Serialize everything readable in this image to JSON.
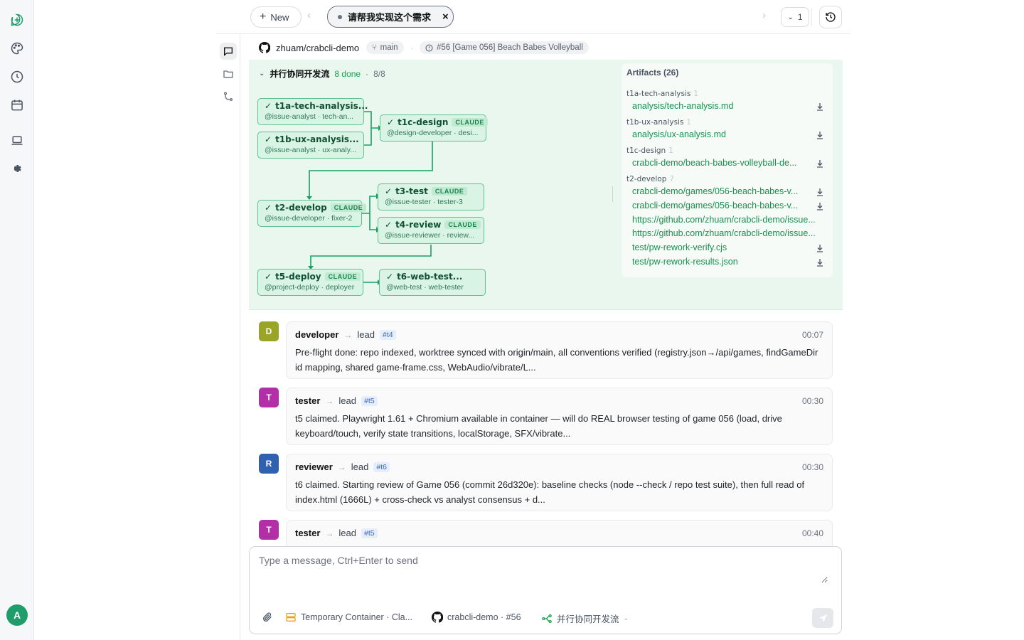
{
  "rail": {
    "icons": [
      "new-chat-icon",
      "palette-icon",
      "history-icon",
      "calendar-icon",
      "laptop-icon",
      "settings-icon"
    ],
    "user_initial": "A"
  },
  "topbar": {
    "new_label": "New",
    "active_tab": "请帮我实现这个需求",
    "count": "1"
  },
  "repo": {
    "name": "zhuam/crabcli-demo",
    "branch": "main",
    "issue": "#56 [Game 056] Beach Babes Volleyball"
  },
  "workflow": {
    "name": "并行协同开发流",
    "done": "8 done",
    "ratio": "8/8",
    "badge": "CLAUDE",
    "nodes": [
      {
        "title": "t1a-tech-analysis...",
        "sub": "@issue-analyst · tech-an..."
      },
      {
        "title": "t1b-ux-analysis...",
        "sub": "@issue-analyst · ux-analy..."
      },
      {
        "title": "t1c-design",
        "sub": "@design-developer · desi..."
      },
      {
        "title": "t2-develop",
        "sub": "@issue-developer · fixer-2"
      },
      {
        "title": "t3-test",
        "sub": "@issue-tester · tester-3"
      },
      {
        "title": "t4-review",
        "sub": "@issue-reviewer · review..."
      },
      {
        "title": "t5-deploy",
        "sub": "@project-deploy · deployer"
      },
      {
        "title": "t6-web-test...",
        "sub": "@web-test · web-tester"
      }
    ]
  },
  "artifacts": {
    "title": "Artifacts (26)",
    "groups": [
      {
        "name": "t1a-tech-analysis",
        "count": "1",
        "items": [
          "analysis/tech-analysis.md"
        ]
      },
      {
        "name": "t1b-ux-analysis",
        "count": "1",
        "items": [
          "analysis/ux-analysis.md"
        ]
      },
      {
        "name": "t1c-design",
        "count": "1",
        "items": [
          "crabcli-demo/beach-babes-volleyball-de..."
        ]
      },
      {
        "name": "t2-develop",
        "count": "7",
        "items": [
          "crabcli-demo/games/056-beach-babes-v...",
          "crabcli-demo/games/056-beach-babes-v...",
          "https://github.com/zhuam/crabcli-demo/issue...",
          "https://github.com/zhuam/crabcli-demo/issue...",
          "test/pw-rework-verify.cjs",
          "test/pw-rework-results.json"
        ]
      }
    ]
  },
  "messages": [
    {
      "initial": "D",
      "color": "#9aa528",
      "from": "developer",
      "to": "lead",
      "tag": "#t4",
      "time": "00:07",
      "body": "Pre-flight done: repo indexed, worktree synced with origin/main, all conventions verified (registry.json→/api/games, findGameDir id mapping, shared game-frame.css, WebAudio/vibrate/L..."
    },
    {
      "initial": "T",
      "color": "#b32fa8",
      "from": "tester",
      "to": "lead",
      "tag": "#t5",
      "time": "00:30",
      "body": "t5 claimed. Playwright 1.61 + Chromium available in container — will do REAL browser testing of game 056 (load, drive keyboard/touch, verify state transitions, localStorage, SFX/vibrate..."
    },
    {
      "initial": "R",
      "color": "#3060b0",
      "from": "reviewer",
      "to": "lead",
      "tag": "#t6",
      "time": "00:30",
      "body": "t6 claimed. Starting review of Game 056 (commit 26d320e): baseline checks (node --check / repo test suite), then full read of index.html (1666L) + cross-check vs analyst consensus + d..."
    },
    {
      "initial": "T",
      "color": "#b32fa8",
      "from": "tester",
      "to": "lead",
      "tag": "#t5",
      "time": "00:40",
      "body": ""
    }
  ],
  "composer": {
    "placeholder": "Type a message, Ctrl+Enter to send",
    "container": "Temporary Container · Cla...",
    "repo": "crabcli-demo · #56",
    "workflow": "并行协同开发流"
  },
  "colors": {
    "accent": "#16a34a",
    "node_border": "#5ec28a",
    "panel_bg": "#e9f7ef"
  }
}
